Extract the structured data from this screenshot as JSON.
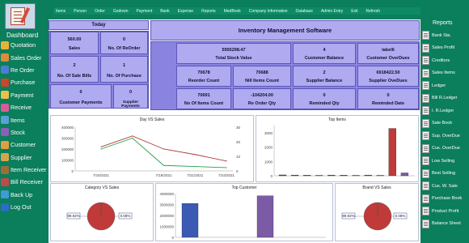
{
  "left_nav": {
    "title": "Dashboard",
    "items": [
      {
        "label": "Quotation",
        "icon": "quotation-icon",
        "color": "#e6b33a"
      },
      {
        "label": "Sales Order",
        "icon": "sales-order-icon",
        "color": "#d98c3c"
      },
      {
        "label": "Re Order",
        "icon": "re-order-icon",
        "color": "#4a7fd0"
      },
      {
        "label": "Purchase",
        "icon": "purchase-icon",
        "color": "#c9462f"
      },
      {
        "label": "Payment",
        "icon": "payment-icon",
        "color": "#e6c24a"
      },
      {
        "label": "Receive",
        "icon": "receive-icon",
        "color": "#d65d9a"
      },
      {
        "label": "Items",
        "icon": "items-icon",
        "color": "#5aa0d6"
      },
      {
        "label": "Stock",
        "icon": "stock-icon",
        "color": "#8a5fb8"
      },
      {
        "label": "Customer",
        "icon": "customer-icon",
        "color": "#e0a040"
      },
      {
        "label": "Supplier",
        "icon": "supplier-icon",
        "color": "#d2a64e"
      },
      {
        "label": "Item Receiver",
        "icon": "item-receiver-icon",
        "color": "#9c6d3a"
      },
      {
        "label": "Bill Receiver",
        "icon": "bill-receiver-icon",
        "color": "#c04a4a"
      },
      {
        "label": "Back Up",
        "icon": "backup-icon",
        "color": "#3f9ad8"
      },
      {
        "label": "Log Out",
        "icon": "logout-icon",
        "color": "#2b6cc4"
      }
    ]
  },
  "menu": [
    "Items",
    "Person",
    "Order",
    "Godown",
    "Payment",
    "Bank",
    "Expense",
    "Reports",
    "MedBook",
    "Company Information",
    "Database",
    "Admin Entry",
    "Exit",
    "Refresh"
  ],
  "today": {
    "title": "Today",
    "cells": [
      {
        "value": "560.00",
        "label": "Sales"
      },
      {
        "value": "0",
        "label": "No. Of ReOrder"
      },
      {
        "value": "2",
        "label": "No. Of Sale Bills"
      },
      {
        "value": "1",
        "label": "No. Of Purchase"
      },
      {
        "value": "0",
        "label": "Customer Payments"
      },
      {
        "value": "0",
        "label": "Supplier Payments"
      }
    ]
  },
  "ims": {
    "title": "Inventory Management Software",
    "cells": [
      {
        "value": "5955298.47",
        "label": "Total Stock Value"
      },
      {
        "value": "4",
        "label": "Customer Balance"
      },
      {
        "value": "label6",
        "label": "Customer OverDues"
      },
      {
        "value": "70678",
        "label": "Reorder Count"
      },
      {
        "value": "70688",
        "label": "Nill Items Count"
      },
      {
        "value": "2",
        "label": "Supplier Balance"
      },
      {
        "value": "6918422.50",
        "label": "Supplier OveDues"
      },
      {
        "value": "70691",
        "label": "No Of Items Count"
      },
      {
        "value": "-104204.00",
        "label": "Re Order Qty"
      },
      {
        "value": "0",
        "label": "Reminded Qty"
      },
      {
        "value": "0",
        "label": "Reminded Date"
      }
    ]
  },
  "right_nav": {
    "title": "Reports",
    "items": [
      "Bank Sta.",
      "Sales Profit",
      "Creditors",
      "Sales Items",
      "Ledger",
      "Bill R.Ledger",
      "I. R.Ledger",
      "Sale Book",
      "Sup. OverDue",
      "Cus. OverDue",
      "Low Selling",
      "Best Selling",
      "Cus. W. Sale",
      "Purchase Book",
      "Product Profit",
      "Balance Sheet"
    ]
  },
  "charts": {
    "day_vs_sales": {
      "title": "Day VS Sales"
    },
    "top_items": {
      "title": "Top Items"
    },
    "category_vs_sales": {
      "title": "Category VS Sales",
      "left_label": "99.92%",
      "right_label": "0.08%"
    },
    "top_customer": {
      "title": "Top Customer"
    },
    "brand_vs_sales": {
      "title": "Brand VS Sales",
      "left_label": "99.92%",
      "right_label": "0.08%"
    }
  },
  "chart_data": [
    {
      "type": "line",
      "title": "Day VS Sales",
      "x": [
        "7/15/2021",
        "7/16/2021",
        "7/18/2021",
        "7/21/2021",
        "7/24/2021"
      ],
      "ylim": [
        0,
        400000
      ],
      "y2lim": [
        0,
        30
      ],
      "series": [
        {
          "values": [
            220000,
            320000,
            200000,
            150000,
            90000
          ],
          "color": "#b03a3a"
        },
        {
          "values": [
            200000,
            300000,
            50000,
            40000,
            30000
          ],
          "color": "#2aa04a"
        }
      ]
    },
    {
      "type": "bar",
      "title": "Top Items",
      "ylim": [
        0,
        3500
      ],
      "categories": [
        "1",
        "2",
        "3",
        "4",
        "5",
        "6",
        "7",
        "8",
        "9",
        "10",
        "11"
      ],
      "values": [
        60,
        50,
        40,
        30,
        50,
        40,
        30,
        50,
        30,
        3300,
        200
      ],
      "colors": [
        "#3a4fa0",
        "#3a4fa0",
        "#3a4fa0",
        "#3a4fa0",
        "#3a4fa0",
        "#3a4fa0",
        "#3a4fa0",
        "#3a4fa0",
        "#3a4fa0",
        "#c03a3a",
        "#7c5ba6"
      ]
    },
    {
      "type": "pie",
      "title": "Category VS Sales",
      "labels": [
        "99.92%",
        "0.08%"
      ],
      "values": [
        99.92,
        0.08
      ],
      "colors": [
        "#c03a3a",
        "#3a4fa0"
      ]
    },
    {
      "type": "bar",
      "title": "Top Customer",
      "ylim": [
        0,
        4000000
      ],
      "categories": [
        "A",
        "B"
      ],
      "values": [
        3100000,
        3800000
      ],
      "colors": [
        "#3a5ab4",
        "#7c5ba6"
      ]
    },
    {
      "type": "pie",
      "title": "Brand VS Sales",
      "labels": [
        "99.92%",
        "0.08%"
      ],
      "values": [
        99.92,
        0.08
      ],
      "colors": [
        "#c03a3a",
        "#3a4fa0"
      ]
    }
  ]
}
